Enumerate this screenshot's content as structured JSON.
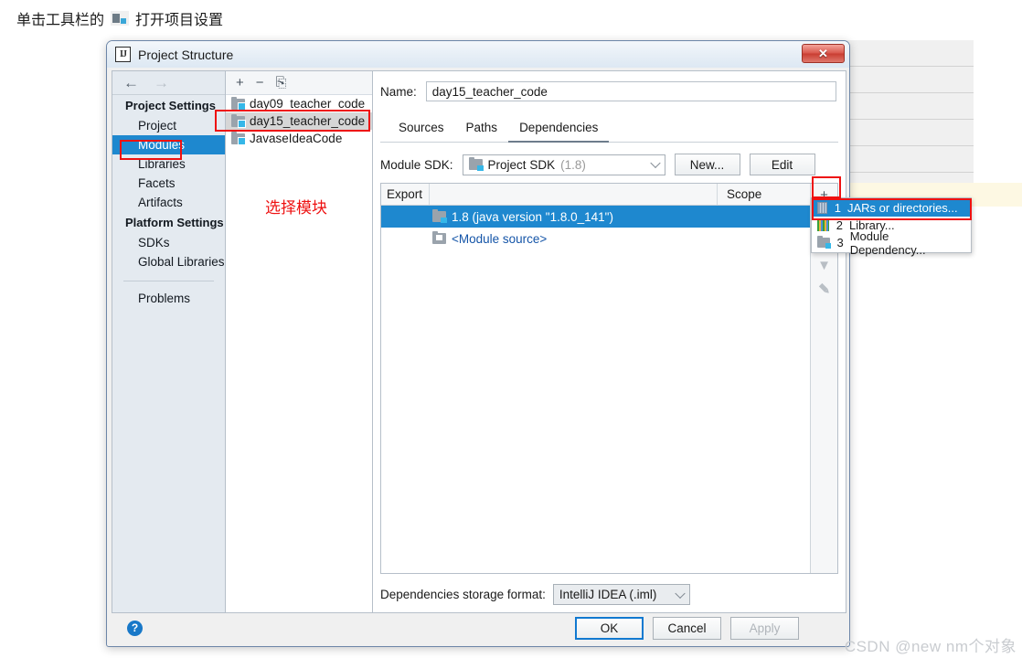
{
  "page": {
    "caption": "单击工具栏的",
    "caption_tail": "打开项目设置",
    "toolbar_icon": "project-structure-icon",
    "watermark": "CSDN @new nm个对象"
  },
  "dialog": {
    "title": "Project Structure",
    "app_icon": "IJ",
    "close_label": "✕"
  },
  "sidebar": {
    "nav": {
      "back": "←",
      "forward": "→"
    },
    "groups": [
      {
        "label": "Project Settings",
        "items": [
          {
            "label": "Project",
            "selected": false
          },
          {
            "label": "Modules",
            "selected": true
          },
          {
            "label": "Libraries",
            "selected": false
          },
          {
            "label": "Facets",
            "selected": false
          },
          {
            "label": "Artifacts",
            "selected": false
          }
        ]
      },
      {
        "label": "Platform Settings",
        "items": [
          {
            "label": "SDKs",
            "selected": false
          },
          {
            "label": "Global Libraries",
            "selected": false
          }
        ]
      }
    ],
    "problems": "Problems"
  },
  "modules": {
    "toolbar": {
      "add": "+",
      "remove": "−",
      "copy": "⎘"
    },
    "items": [
      {
        "name": "day09_teacher_code",
        "selected": false
      },
      {
        "name": "day15_teacher_code",
        "selected": true
      },
      {
        "name": "JavaseIdeaCode",
        "selected": false
      }
    ]
  },
  "pane": {
    "name_label": "Name:",
    "name_value": "day15_teacher_code",
    "tabs": [
      {
        "label": "Sources",
        "active": false
      },
      {
        "label": "Paths",
        "active": false
      },
      {
        "label": "Dependencies",
        "active": true
      }
    ],
    "sdk_label": "Module SDK:",
    "sdk_value": "Project SDK",
    "sdk_version": "(1.8)",
    "new_button": "New...",
    "edit_button": "Edit",
    "table": {
      "columns": [
        "Export",
        "Scope"
      ],
      "rows": [
        {
          "label": "1.8 (java version \"1.8.0_141\")",
          "icon": "sdk-icon",
          "selected": true
        },
        {
          "label": "<Module source>",
          "icon": "module-source-icon",
          "selected": false
        }
      ]
    },
    "rail": {
      "add": "+",
      "remove": "−",
      "up": "▲",
      "down": "▼",
      "edit": "edit-pencil-icon"
    },
    "storage_label": "Dependencies storage format:",
    "storage_value": "IntelliJ IDEA (.iml)"
  },
  "popup": {
    "items": [
      {
        "num": "1",
        "label": "JARs or directories...",
        "icon": "jar-icon",
        "highlighted": true
      },
      {
        "num": "2",
        "label": "Library...",
        "icon": "library-icon",
        "highlighted": false
      },
      {
        "num": "3",
        "label": "Module Dependency...",
        "icon": "module-dependency-icon",
        "highlighted": false
      }
    ]
  },
  "footer": {
    "help": "?",
    "ok": "OK",
    "cancel": "Cancel",
    "apply": "Apply"
  },
  "annotations": {
    "select_module": "选择模块"
  },
  "colors": {
    "selection_blue": "#1e88cf",
    "annotation_red": "#ee1111",
    "accent_focus": "#1179d0"
  }
}
